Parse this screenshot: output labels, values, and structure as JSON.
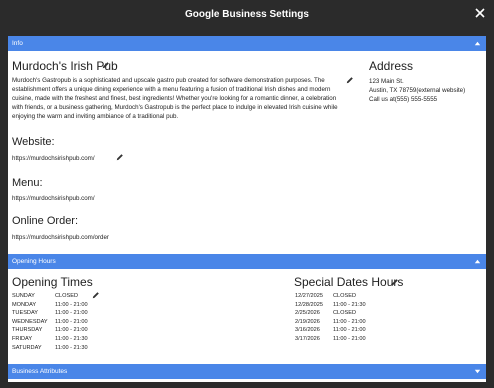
{
  "window": {
    "title": "Google Business Settings"
  },
  "sections": {
    "info": "Info",
    "opening_hours": "Opening Hours",
    "business_attributes": "Business Attributes"
  },
  "info": {
    "business_name": "Murdoch's Irish Pub",
    "description": "Murdoch's Gastropub is a sophisticated and upscale gastro pub created for software demonstration purposes. The establishment offers a unique dining experience with a menu featuring a fusion of traditional Irish dishes and modern cuisine, made with the freshest and finest, best ingredients! Whether you're looking for a romantic dinner, a celebration with friends, or a business gathering, Murdoch's Gastropub is the perfect place to indulge in elevated Irish cuisine while enjoying the warm and inviting ambiance of a traditional pub.",
    "address_heading": "Address",
    "address_lines": [
      "123 Main St.",
      "Austin, TX 78759(external website)",
      "Call us at(555) 555-5555"
    ],
    "website_heading": "Website:",
    "website_url": "https://murdochsirishpub.com/",
    "menu_heading": "Menu:",
    "menu_url": "https://murdochsirishpub.com/",
    "order_heading": "Online Order:",
    "order_url": "https://murdochsirishpub.com/order"
  },
  "hours": {
    "heading": "Opening Times",
    "rows": [
      {
        "day": "SUNDAY",
        "time": "CLOSED"
      },
      {
        "day": "MONDAY",
        "time": "11:00 - 21:00"
      },
      {
        "day": "TUESDAY",
        "time": "11:00 - 21:00"
      },
      {
        "day": "WEDNESDAY",
        "time": "11:00 - 21:00"
      },
      {
        "day": "THURSDAY",
        "time": "11:00 - 21:00"
      },
      {
        "day": "FRIDAY",
        "time": "11:00 - 21:30"
      },
      {
        "day": "SATURDAY",
        "time": "11:00 - 21:30"
      }
    ]
  },
  "special": {
    "heading": "Special Dates Hours",
    "rows": [
      {
        "date": "12/27/2025",
        "time": "CLOSED"
      },
      {
        "date": "12/28/2025",
        "time": "11:00 - 21:30"
      },
      {
        "date": "2/25/2026",
        "time": "CLOSED"
      },
      {
        "date": "2/19/2026",
        "time": "11:00 - 21:00"
      },
      {
        "date": "3/16/2026",
        "time": "11:00 - 21:00"
      },
      {
        "date": "3/17/2026",
        "time": "11:00 - 21:00"
      }
    ]
  },
  "colors": {
    "section_bar": "#4a86e8",
    "titlebar": "#2b2b2b"
  },
  "icons": {
    "edit": "pencil-icon",
    "collapse": "chevron-up-icon",
    "expand": "chevron-down-icon",
    "close": "close-icon"
  }
}
